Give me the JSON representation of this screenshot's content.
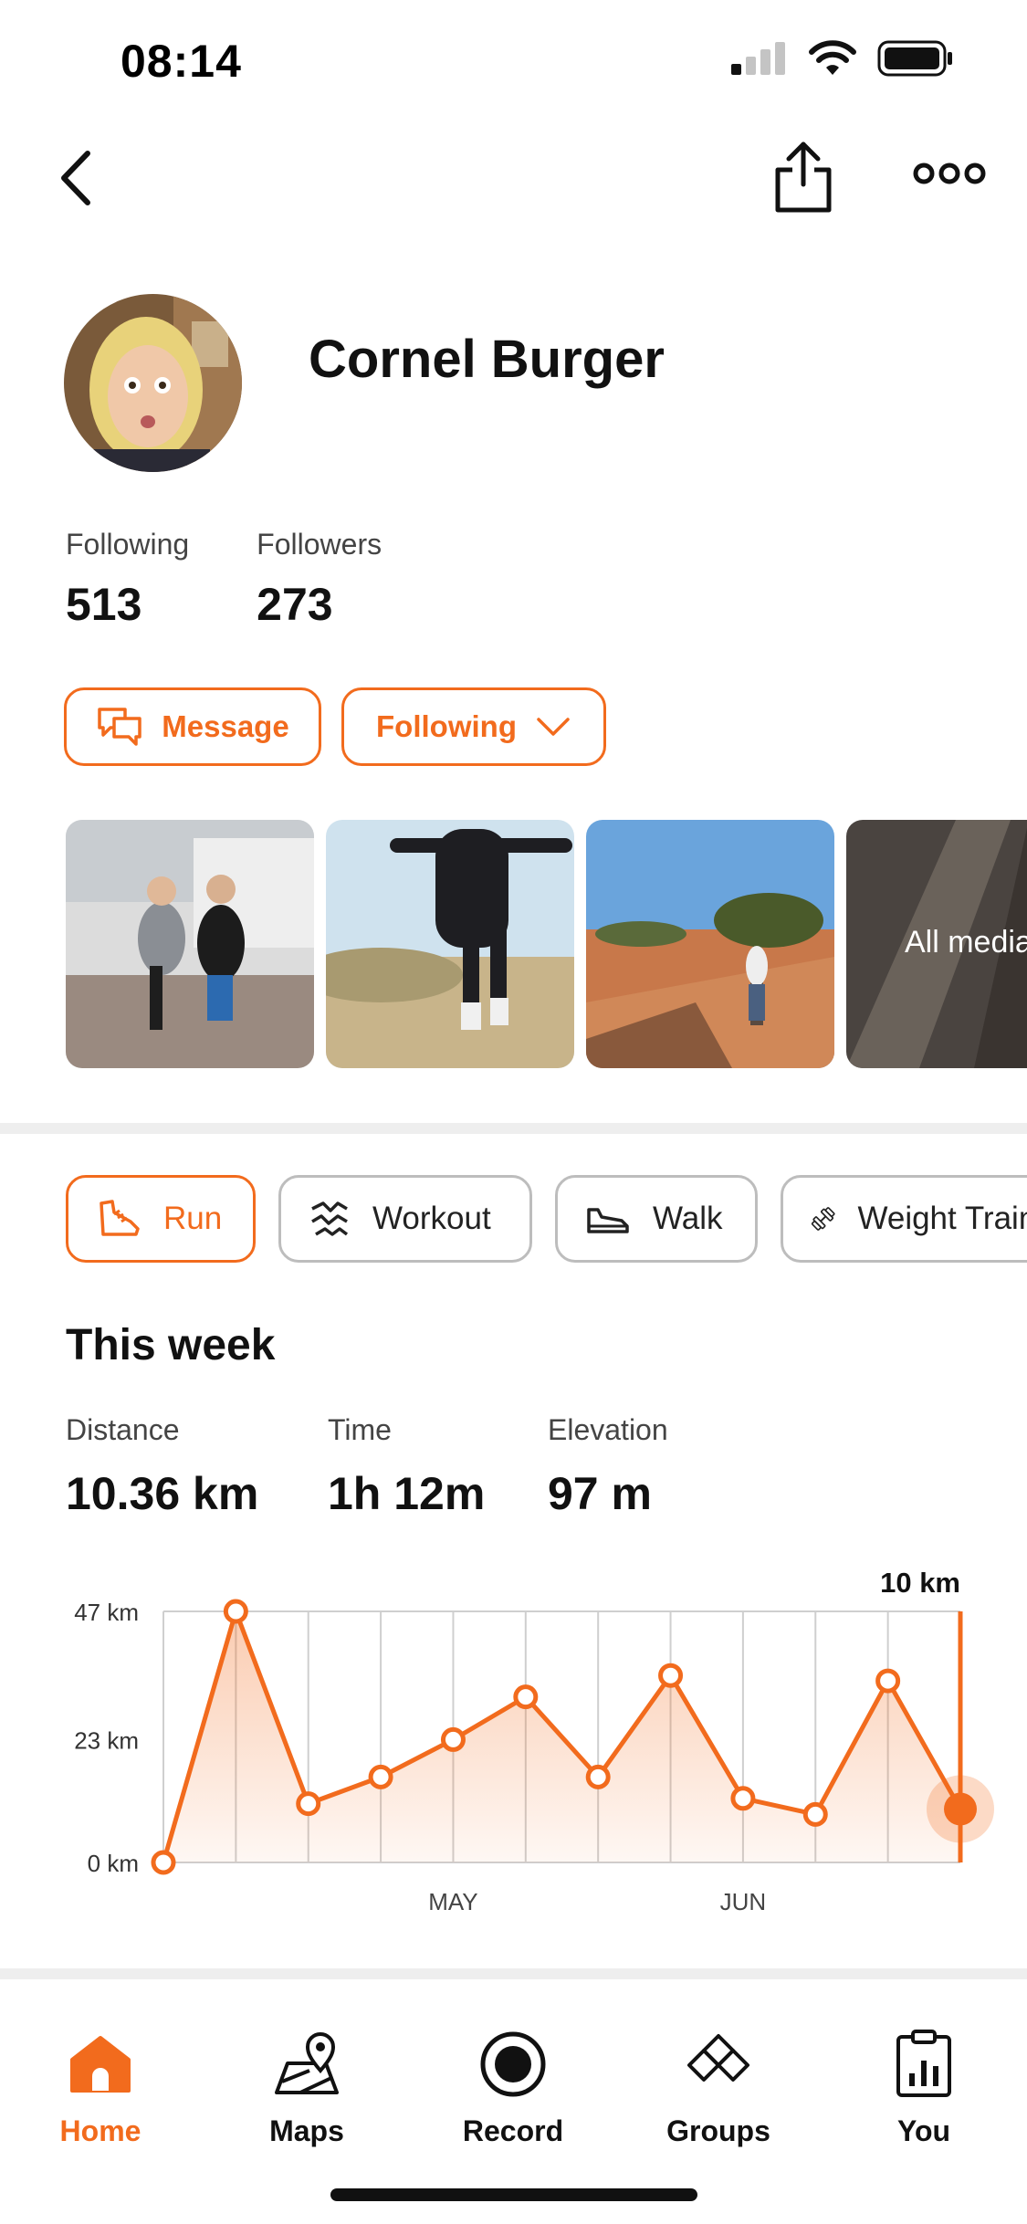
{
  "status_bar": {
    "time": "08:14"
  },
  "profile": {
    "name": "Cornel Burger"
  },
  "stats": [
    {
      "label": "Following",
      "value": "513"
    },
    {
      "label": "Followers",
      "value": "273"
    }
  ],
  "actions": {
    "message_label": "Message",
    "following_label": "Following"
  },
  "media": {
    "all_media_label": "All media"
  },
  "sport_tabs": [
    {
      "label": "Run",
      "icon": "shoe-icon",
      "active": true
    },
    {
      "label": "Workout",
      "icon": "workout-icon",
      "active": false
    },
    {
      "label": "Walk",
      "icon": "walk-shoe-icon",
      "active": false
    },
    {
      "label": "Weight Training",
      "icon": "dumbbell-icon",
      "active": false
    }
  ],
  "week": {
    "title": "This week",
    "stats": [
      {
        "label": "Distance",
        "value": "10.36 km"
      },
      {
        "label": "Time",
        "value": "1h 12m"
      },
      {
        "label": "Elevation",
        "value": "97 m"
      }
    ]
  },
  "chart_data": {
    "type": "area",
    "title": "",
    "xlabel": "",
    "ylabel": "",
    "y_ticks": [
      "47 km",
      "23 km",
      "0 km"
    ],
    "y_tick_values": [
      47,
      23,
      0
    ],
    "ylim": [
      0,
      47
    ],
    "x_tick_labels": [
      {
        "label": "MAY",
        "index": 4
      },
      {
        "label": "JUN",
        "index": 8
      }
    ],
    "values": [
      0,
      47,
      11,
      16,
      23,
      31,
      16,
      35,
      12,
      9,
      34,
      10
    ],
    "current_label": "10 km",
    "grid": true,
    "accent": "#f26b1d"
  },
  "tab_bar": {
    "items": [
      {
        "label": "Home",
        "icon": "home-icon",
        "active": true
      },
      {
        "label": "Maps",
        "icon": "maps-icon",
        "active": false
      },
      {
        "label": "Record",
        "icon": "record-icon",
        "active": false
      },
      {
        "label": "Groups",
        "icon": "groups-icon",
        "active": false
      },
      {
        "label": "You",
        "icon": "clipboard-icon",
        "active": false
      }
    ]
  },
  "colors": {
    "accent": "#f26b1d",
    "text": "#111111",
    "muted": "#444444"
  }
}
